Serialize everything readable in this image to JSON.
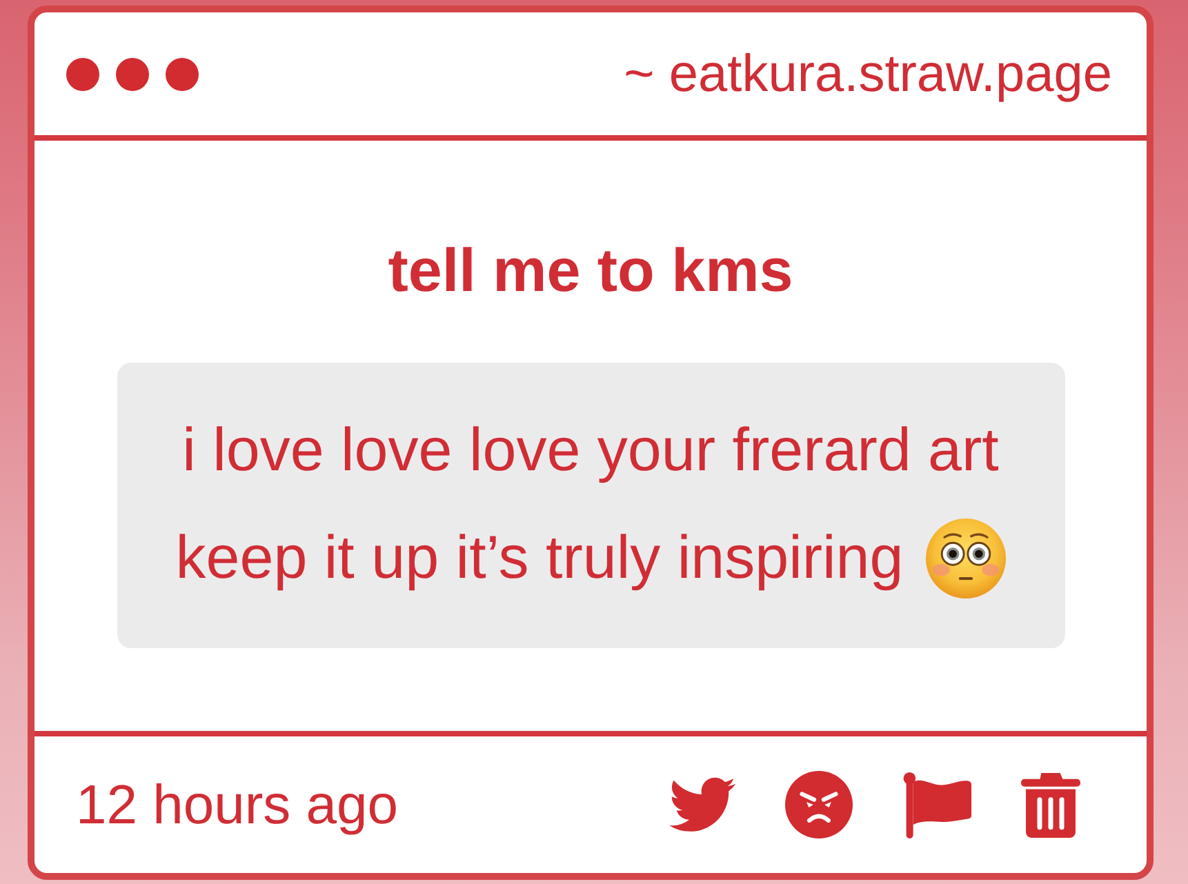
{
  "window": {
    "url": "~ eatkura.straw.page"
  },
  "question": {
    "title": "tell me to kms",
    "message_lines": [
      "i love love love your frerard art",
      "keep it up it’s truly inspiring"
    ]
  },
  "footer": {
    "time": "12 hours ago",
    "actions": [
      {
        "kind": "bird"
      },
      {
        "kind": "angry"
      },
      {
        "kind": "flag"
      },
      {
        "kind": "trash"
      }
    ]
  }
}
